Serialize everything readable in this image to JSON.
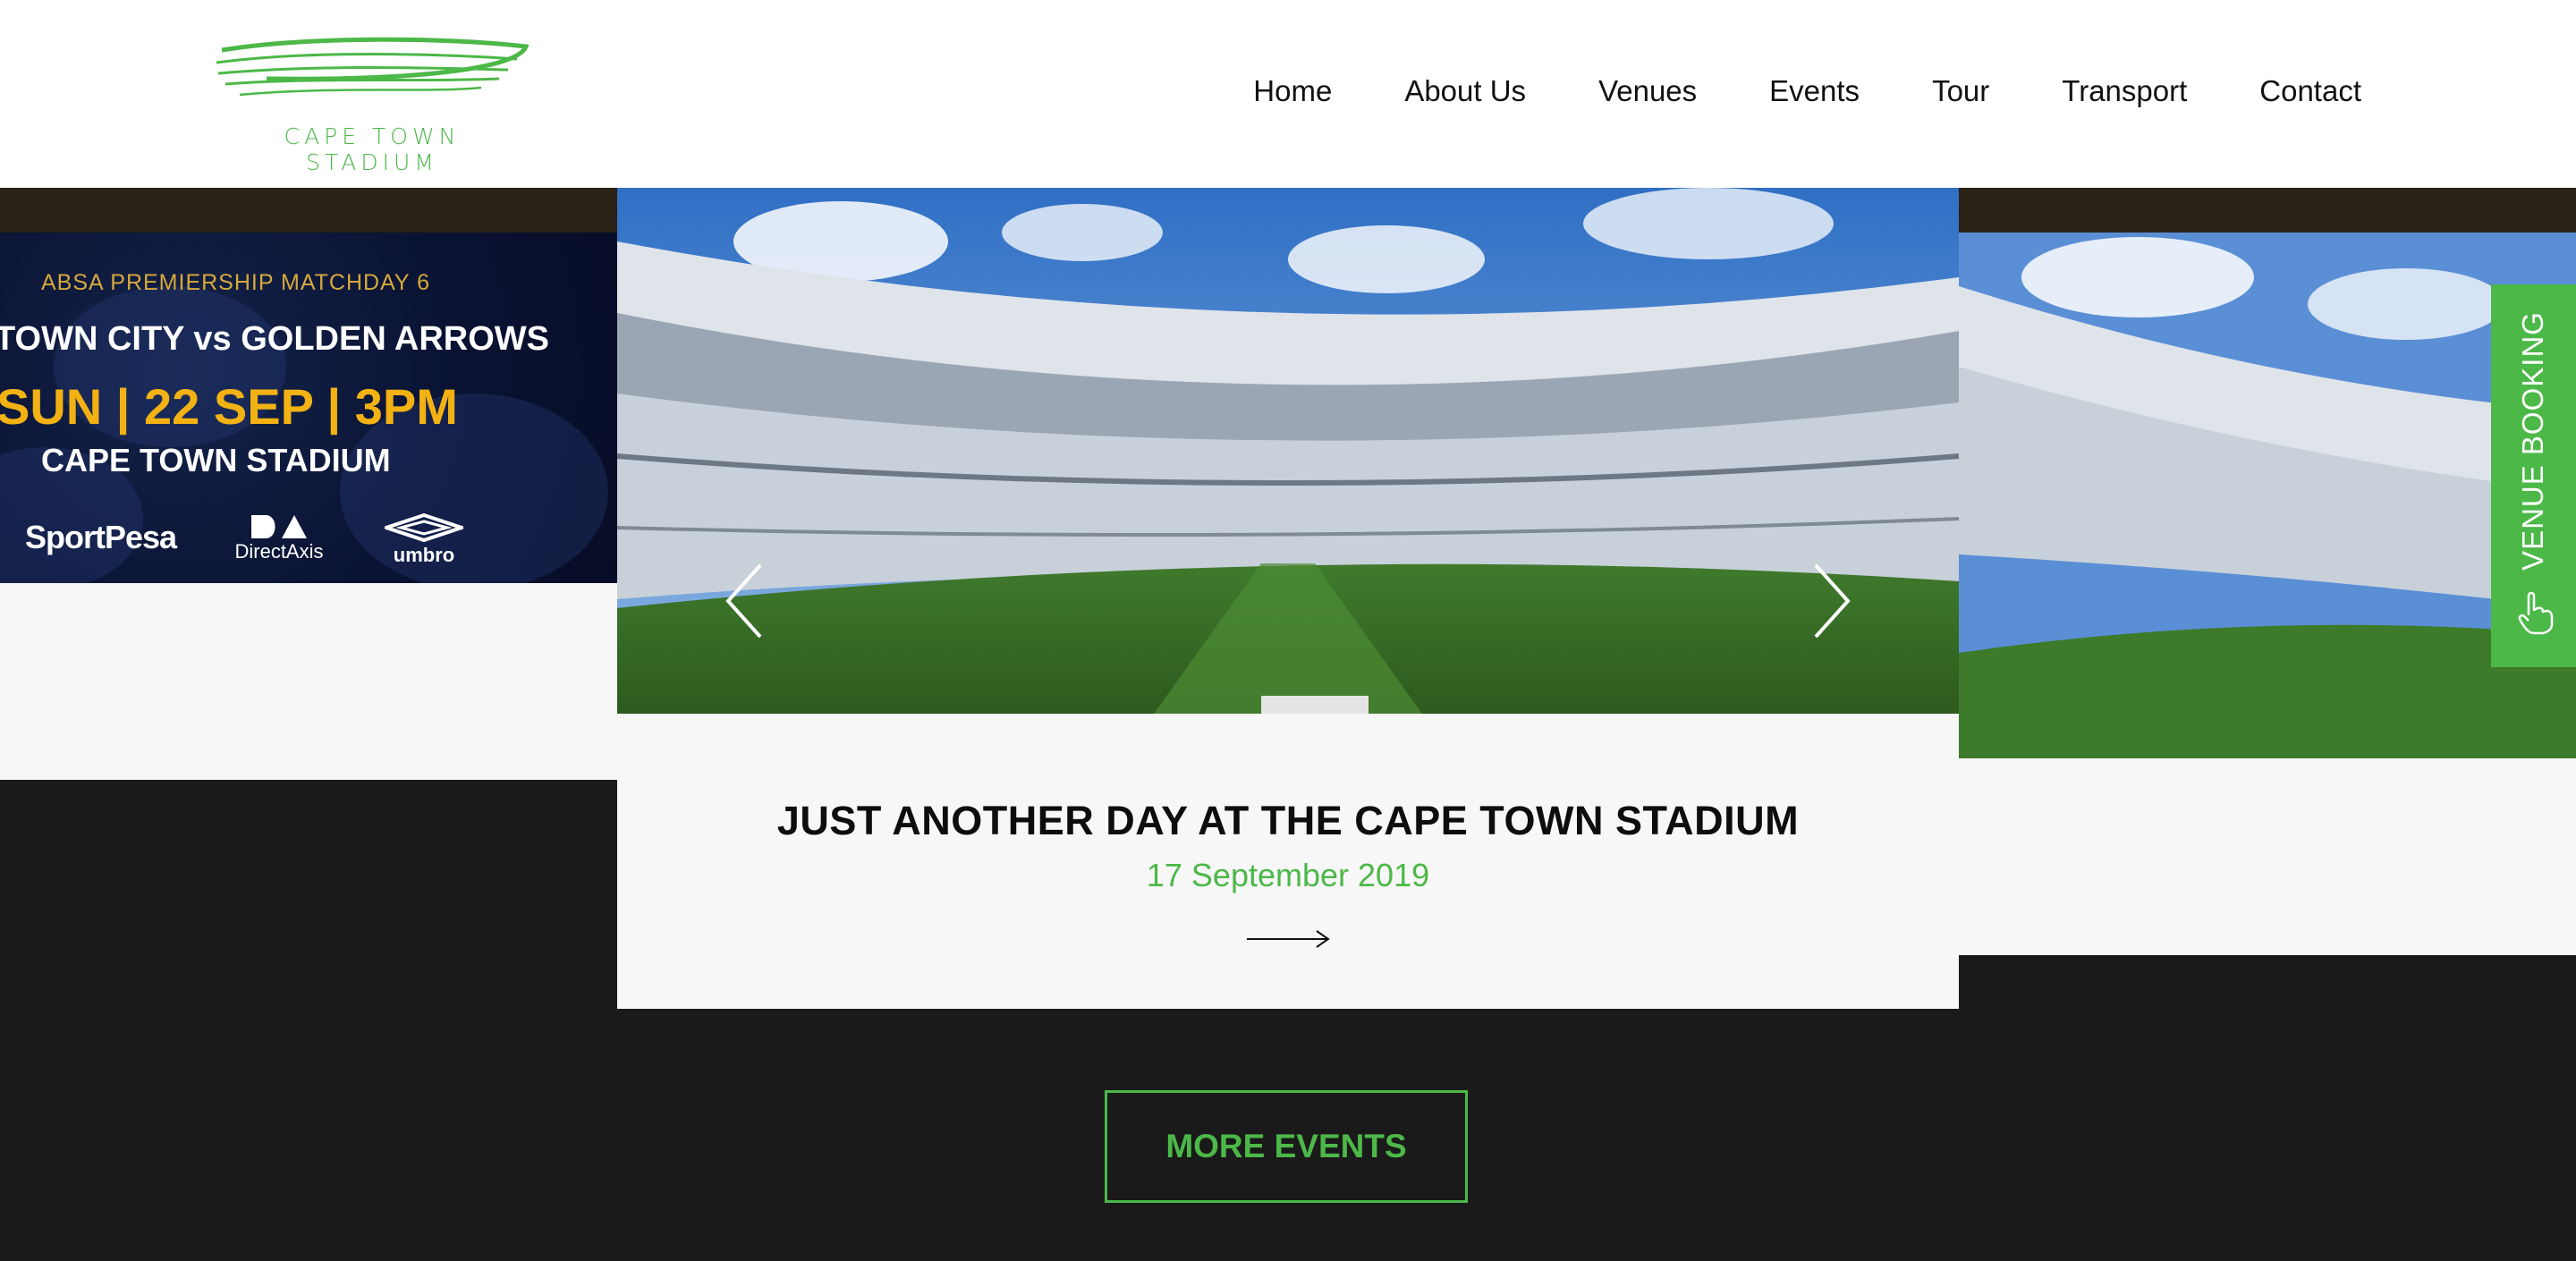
{
  "header": {
    "logo_text": "CAPE TOWN STADIUM",
    "nav": [
      "Home",
      "About Us",
      "Venues",
      "Events",
      "Tour",
      "Transport",
      "Contact"
    ]
  },
  "promo": {
    "line1": "ABSA PREMIERSHIP MATCHDAY 6",
    "line2": "TOWN CITY vs GOLDEN ARROWS",
    "line3": "SUN | 22 SEP | 3PM",
    "line4": "CAPE TOWN STADIUM",
    "sponsors": [
      "SportPesa",
      "DirectAxis",
      "umbro"
    ]
  },
  "slide": {
    "title": "JUST ANOTHER DAY AT THE CAPE TOWN STADIUM",
    "date": "17 September 2019"
  },
  "booking": {
    "label": "VENUE BOOKING"
  },
  "more_events": {
    "label": "MORE EVENTS"
  },
  "colors": {
    "accent": "#4cb848",
    "dark": "#1a1a1a",
    "light": "#f7f7f7",
    "promo_gold": "#f2b214"
  },
  "icons": [
    "chevron-left-icon",
    "chevron-right-icon",
    "arrow-right-icon",
    "hand-pointer-icon"
  ]
}
